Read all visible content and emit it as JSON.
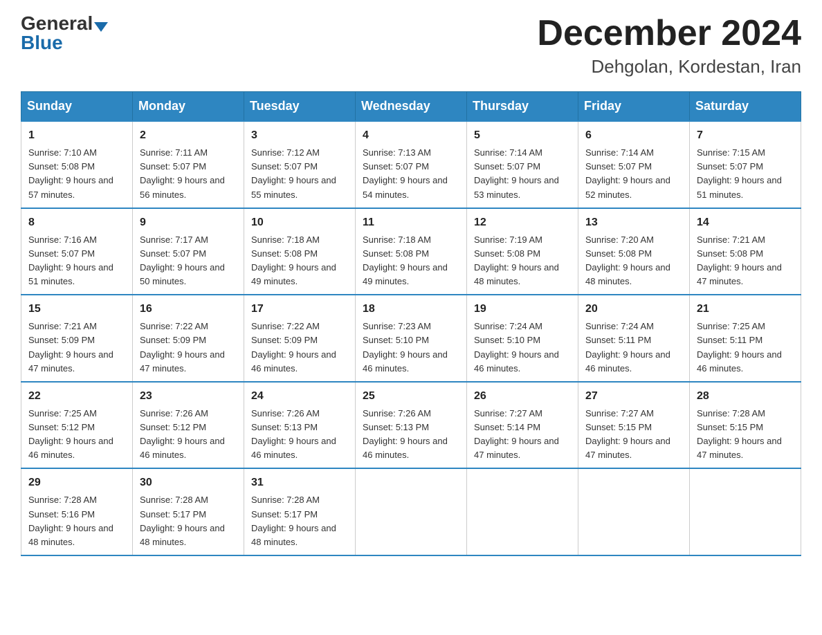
{
  "logo": {
    "general": "General",
    "blue": "Blue"
  },
  "title": {
    "month_year": "December 2024",
    "location": "Dehgolan, Kordestan, Iran"
  },
  "weekdays": [
    "Sunday",
    "Monday",
    "Tuesday",
    "Wednesday",
    "Thursday",
    "Friday",
    "Saturday"
  ],
  "weeks": [
    [
      {
        "day": "1",
        "sunrise": "7:10 AM",
        "sunset": "5:08 PM",
        "daylight": "9 hours and 57 minutes."
      },
      {
        "day": "2",
        "sunrise": "7:11 AM",
        "sunset": "5:07 PM",
        "daylight": "9 hours and 56 minutes."
      },
      {
        "day": "3",
        "sunrise": "7:12 AM",
        "sunset": "5:07 PM",
        "daylight": "9 hours and 55 minutes."
      },
      {
        "day": "4",
        "sunrise": "7:13 AM",
        "sunset": "5:07 PM",
        "daylight": "9 hours and 54 minutes."
      },
      {
        "day": "5",
        "sunrise": "7:14 AM",
        "sunset": "5:07 PM",
        "daylight": "9 hours and 53 minutes."
      },
      {
        "day": "6",
        "sunrise": "7:14 AM",
        "sunset": "5:07 PM",
        "daylight": "9 hours and 52 minutes."
      },
      {
        "day": "7",
        "sunrise": "7:15 AM",
        "sunset": "5:07 PM",
        "daylight": "9 hours and 51 minutes."
      }
    ],
    [
      {
        "day": "8",
        "sunrise": "7:16 AM",
        "sunset": "5:07 PM",
        "daylight": "9 hours and 51 minutes."
      },
      {
        "day": "9",
        "sunrise": "7:17 AM",
        "sunset": "5:07 PM",
        "daylight": "9 hours and 50 minutes."
      },
      {
        "day": "10",
        "sunrise": "7:18 AM",
        "sunset": "5:08 PM",
        "daylight": "9 hours and 49 minutes."
      },
      {
        "day": "11",
        "sunrise": "7:18 AM",
        "sunset": "5:08 PM",
        "daylight": "9 hours and 49 minutes."
      },
      {
        "day": "12",
        "sunrise": "7:19 AM",
        "sunset": "5:08 PM",
        "daylight": "9 hours and 48 minutes."
      },
      {
        "day": "13",
        "sunrise": "7:20 AM",
        "sunset": "5:08 PM",
        "daylight": "9 hours and 48 minutes."
      },
      {
        "day": "14",
        "sunrise": "7:21 AM",
        "sunset": "5:08 PM",
        "daylight": "9 hours and 47 minutes."
      }
    ],
    [
      {
        "day": "15",
        "sunrise": "7:21 AM",
        "sunset": "5:09 PM",
        "daylight": "9 hours and 47 minutes."
      },
      {
        "day": "16",
        "sunrise": "7:22 AM",
        "sunset": "5:09 PM",
        "daylight": "9 hours and 47 minutes."
      },
      {
        "day": "17",
        "sunrise": "7:22 AM",
        "sunset": "5:09 PM",
        "daylight": "9 hours and 46 minutes."
      },
      {
        "day": "18",
        "sunrise": "7:23 AM",
        "sunset": "5:10 PM",
        "daylight": "9 hours and 46 minutes."
      },
      {
        "day": "19",
        "sunrise": "7:24 AM",
        "sunset": "5:10 PM",
        "daylight": "9 hours and 46 minutes."
      },
      {
        "day": "20",
        "sunrise": "7:24 AM",
        "sunset": "5:11 PM",
        "daylight": "9 hours and 46 minutes."
      },
      {
        "day": "21",
        "sunrise": "7:25 AM",
        "sunset": "5:11 PM",
        "daylight": "9 hours and 46 minutes."
      }
    ],
    [
      {
        "day": "22",
        "sunrise": "7:25 AM",
        "sunset": "5:12 PM",
        "daylight": "9 hours and 46 minutes."
      },
      {
        "day": "23",
        "sunrise": "7:26 AM",
        "sunset": "5:12 PM",
        "daylight": "9 hours and 46 minutes."
      },
      {
        "day": "24",
        "sunrise": "7:26 AM",
        "sunset": "5:13 PM",
        "daylight": "9 hours and 46 minutes."
      },
      {
        "day": "25",
        "sunrise": "7:26 AM",
        "sunset": "5:13 PM",
        "daylight": "9 hours and 46 minutes."
      },
      {
        "day": "26",
        "sunrise": "7:27 AM",
        "sunset": "5:14 PM",
        "daylight": "9 hours and 47 minutes."
      },
      {
        "day": "27",
        "sunrise": "7:27 AM",
        "sunset": "5:15 PM",
        "daylight": "9 hours and 47 minutes."
      },
      {
        "day": "28",
        "sunrise": "7:28 AM",
        "sunset": "5:15 PM",
        "daylight": "9 hours and 47 minutes."
      }
    ],
    [
      {
        "day": "29",
        "sunrise": "7:28 AM",
        "sunset": "5:16 PM",
        "daylight": "9 hours and 48 minutes."
      },
      {
        "day": "30",
        "sunrise": "7:28 AM",
        "sunset": "5:17 PM",
        "daylight": "9 hours and 48 minutes."
      },
      {
        "day": "31",
        "sunrise": "7:28 AM",
        "sunset": "5:17 PM",
        "daylight": "9 hours and 48 minutes."
      },
      null,
      null,
      null,
      null
    ]
  ]
}
